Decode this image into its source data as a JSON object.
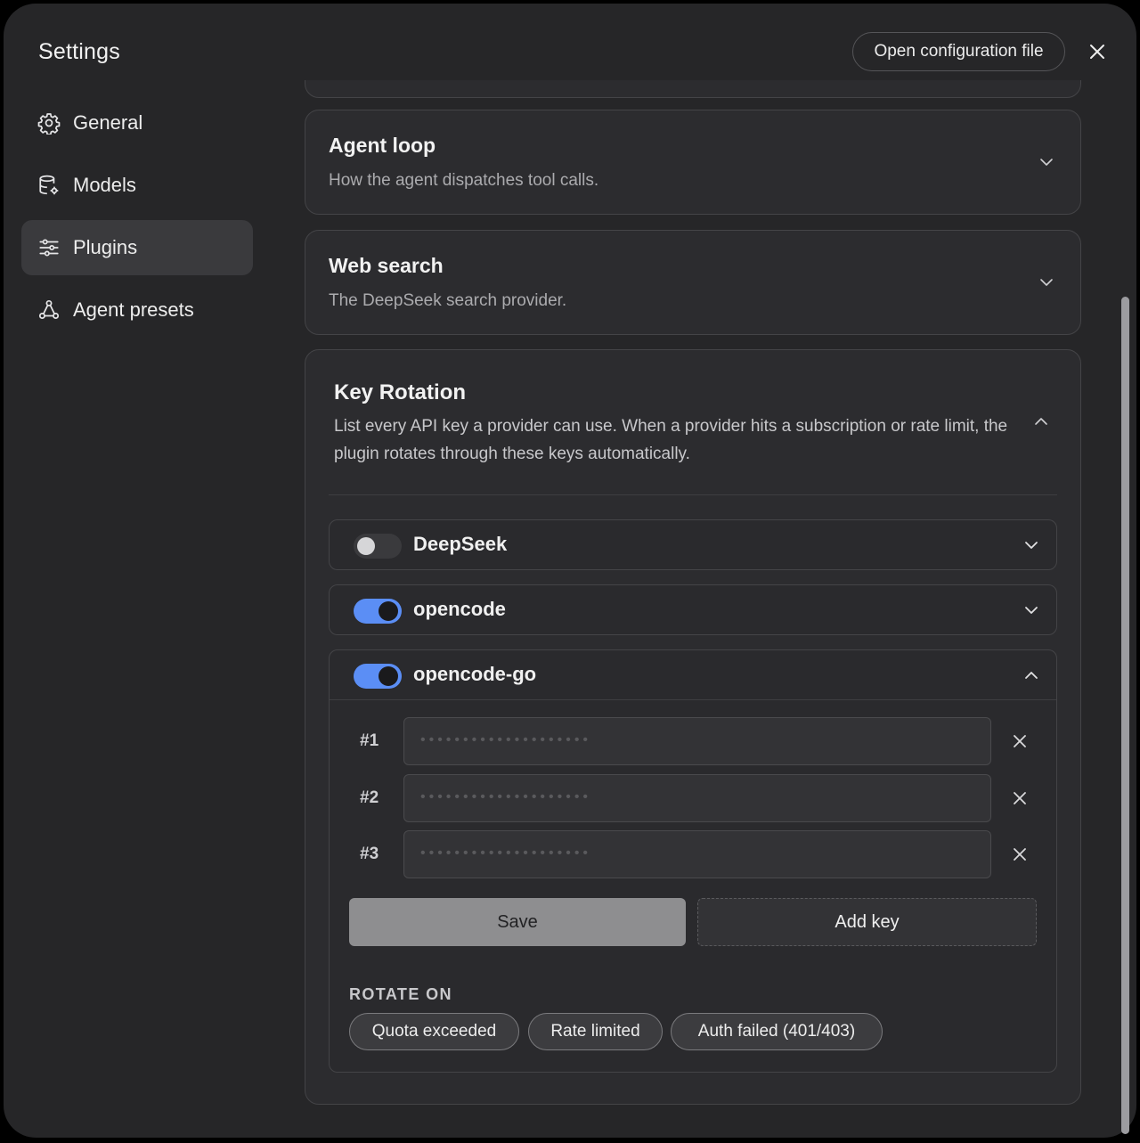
{
  "window": {
    "title": "Settings",
    "open_config_label": "Open configuration file"
  },
  "sidebar": {
    "items": [
      {
        "label": "General",
        "icon": "gear-icon",
        "active": false
      },
      {
        "label": "Models",
        "icon": "database-gear-icon",
        "active": false
      },
      {
        "label": "Plugins",
        "icon": "sliders-icon",
        "active": true
      },
      {
        "label": "Agent presets",
        "icon": "nodes-icon",
        "active": false
      }
    ]
  },
  "sections": {
    "agent_loop": {
      "title": "Agent loop",
      "description": "How the agent dispatches tool calls."
    },
    "web_search": {
      "title": "Web search",
      "description": "The DeepSeek search provider."
    },
    "key_rotation": {
      "title": "Key Rotation",
      "description": "List every API key a provider can use. When a provider hits a subscription or rate limit, the plugin rotates through these keys automatically.",
      "providers": [
        {
          "name": "DeepSeek",
          "enabled": false,
          "expanded": false
        },
        {
          "name": "opencode",
          "enabled": true,
          "expanded": false
        },
        {
          "name": "opencode-go",
          "enabled": true,
          "expanded": true
        }
      ],
      "keys": [
        {
          "label": "#1",
          "value": "••••••••••••••••••••"
        },
        {
          "label": "#2",
          "value": "••••••••••••••••••••"
        },
        {
          "label": "#3",
          "value": "••••••••••••••••••••"
        }
      ],
      "save_label": "Save",
      "add_key_label": "Add key",
      "rotate_on_label": "ROTATE ON",
      "rotate_on_options": [
        "Quota exceeded",
        "Rate limited",
        "Auth failed (401/403)"
      ]
    }
  },
  "colors": {
    "background": "#262628",
    "card": "#2C2C2F",
    "accent": "#5B8EF5",
    "active_nav": "#3A3A3D"
  }
}
